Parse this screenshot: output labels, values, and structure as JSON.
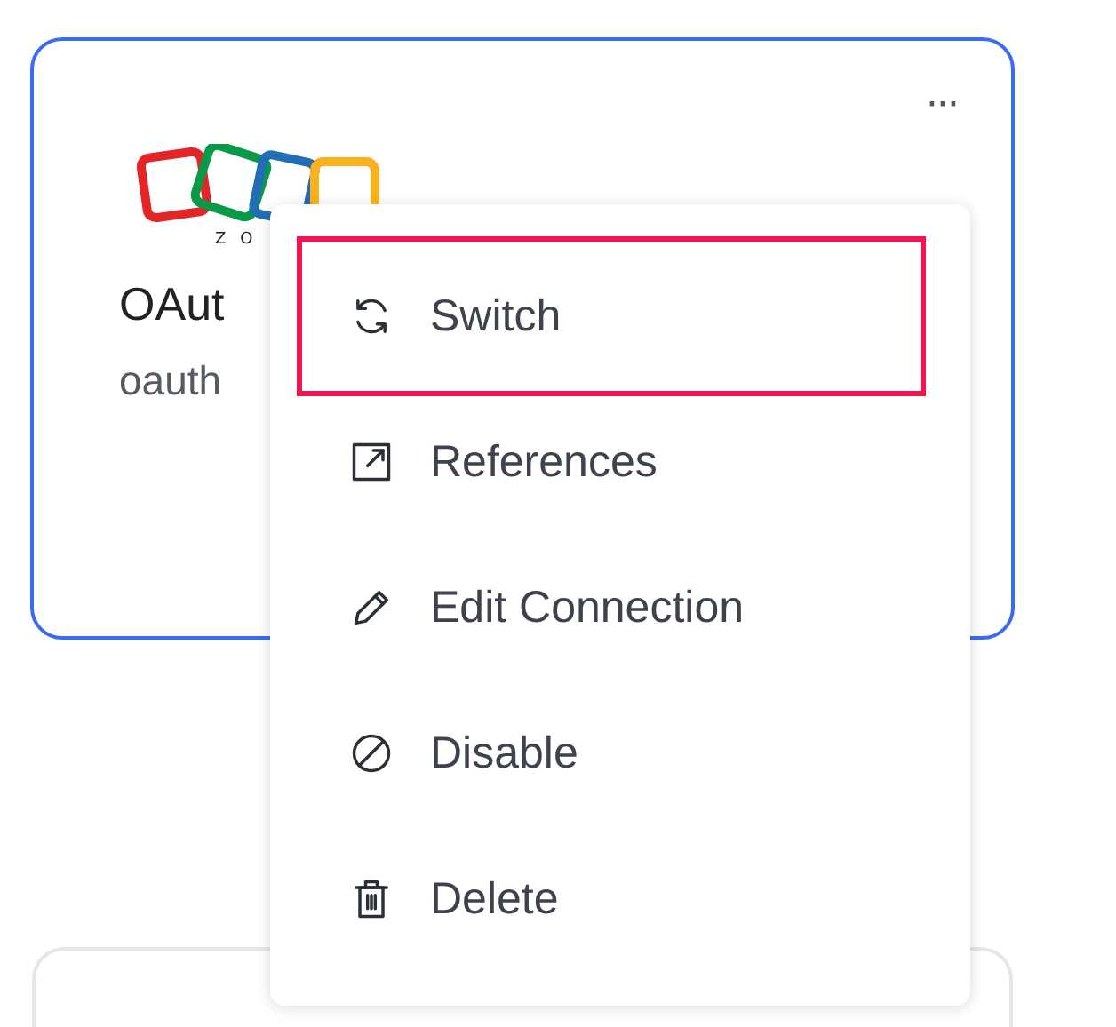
{
  "card": {
    "logo_text": "ZO",
    "title": "OAut",
    "subtitle": "oauth",
    "selected": true,
    "more_label": "···"
  },
  "menu": {
    "items": [
      {
        "kind": "switch",
        "label": "Switch",
        "highlighted": true
      },
      {
        "kind": "references",
        "label": "References",
        "highlighted": false
      },
      {
        "kind": "edit",
        "label": "Edit Connection",
        "highlighted": false
      },
      {
        "kind": "disable",
        "label": "Disable",
        "highlighted": false
      },
      {
        "kind": "delete",
        "label": "Delete",
        "highlighted": false
      }
    ]
  },
  "next_card": {
    "kind": "card"
  }
}
